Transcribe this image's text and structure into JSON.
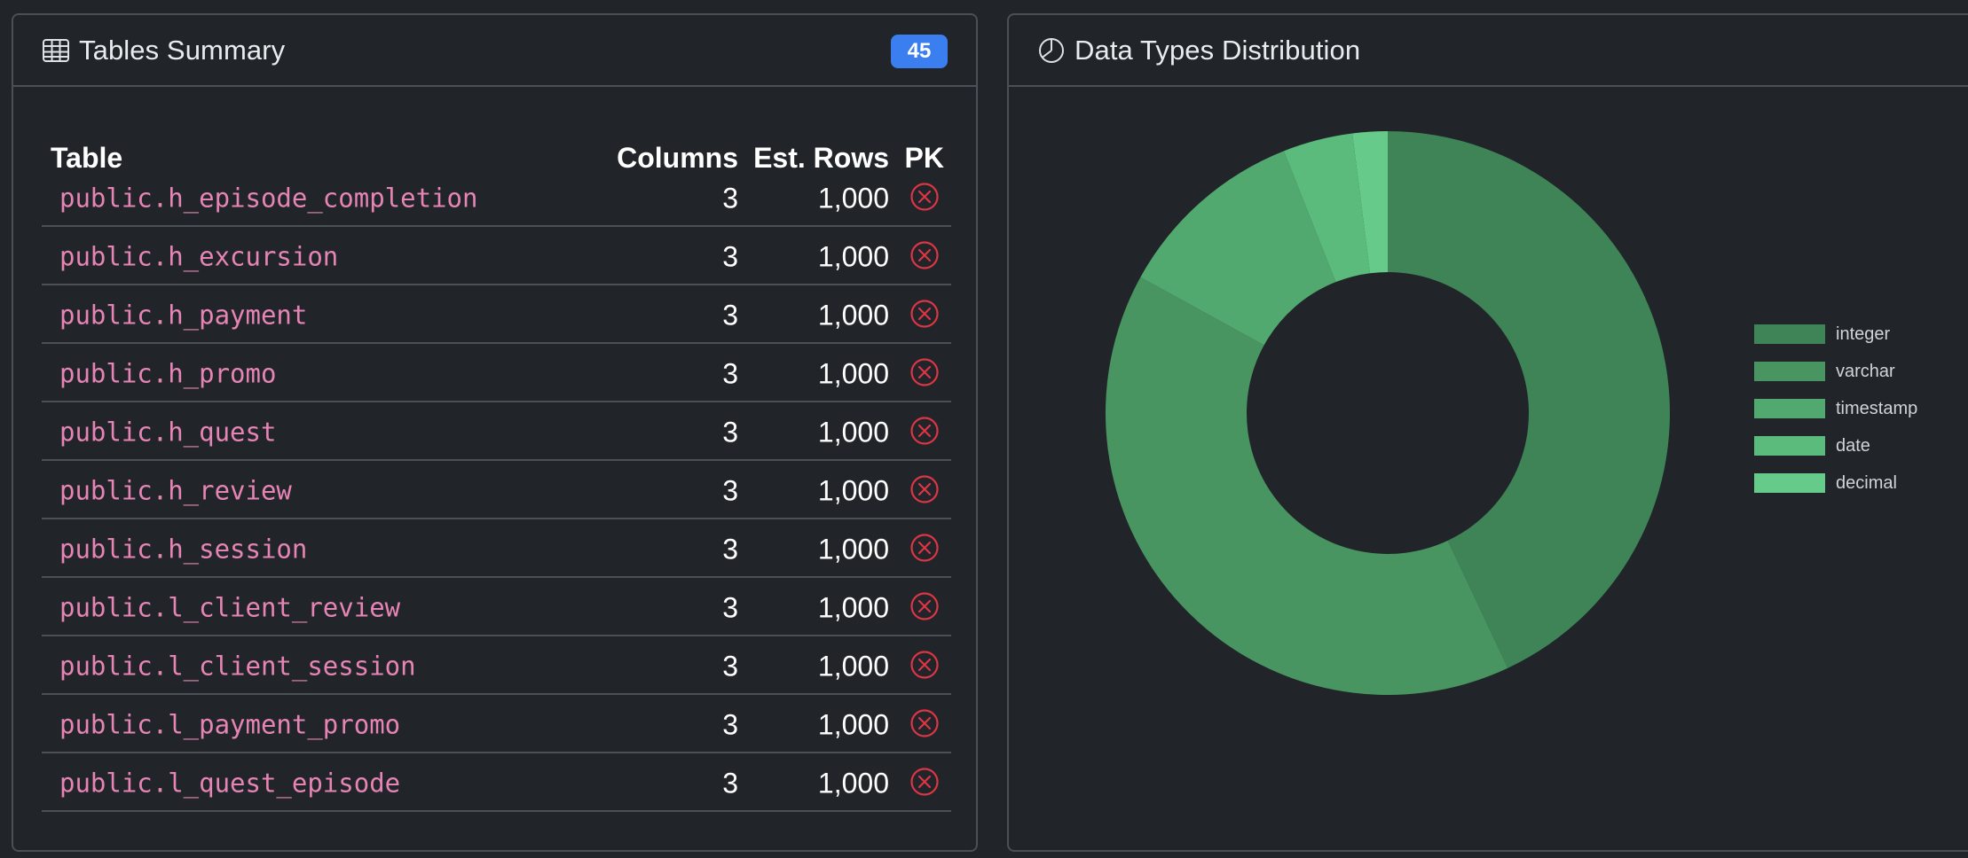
{
  "tables_card": {
    "title": "Tables Summary",
    "count_badge": "45",
    "columns": {
      "table": "Table",
      "columns": "Columns",
      "est_rows": "Est. Rows",
      "pk": "PK"
    },
    "rows": [
      {
        "name": "public.h_episode_completion",
        "columns": "3",
        "est_rows": "1,000",
        "pk": "no"
      },
      {
        "name": "public.h_excursion",
        "columns": "3",
        "est_rows": "1,000",
        "pk": "no"
      },
      {
        "name": "public.h_payment",
        "columns": "3",
        "est_rows": "1,000",
        "pk": "no"
      },
      {
        "name": "public.h_promo",
        "columns": "3",
        "est_rows": "1,000",
        "pk": "no"
      },
      {
        "name": "public.h_quest",
        "columns": "3",
        "est_rows": "1,000",
        "pk": "no"
      },
      {
        "name": "public.h_review",
        "columns": "3",
        "est_rows": "1,000",
        "pk": "no"
      },
      {
        "name": "public.h_session",
        "columns": "3",
        "est_rows": "1,000",
        "pk": "no"
      },
      {
        "name": "public.l_client_review",
        "columns": "3",
        "est_rows": "1,000",
        "pk": "no"
      },
      {
        "name": "public.l_client_session",
        "columns": "3",
        "est_rows": "1,000",
        "pk": "no"
      },
      {
        "name": "public.l_payment_promo",
        "columns": "3",
        "est_rows": "1,000",
        "pk": "no"
      },
      {
        "name": "public.l_quest_episode",
        "columns": "3",
        "est_rows": "1,000",
        "pk": "no"
      }
    ]
  },
  "types_card": {
    "title": "Data Types Distribution"
  },
  "chart_data": {
    "type": "pie",
    "donut": true,
    "title": "",
    "legend_position": "right",
    "categories": [
      "integer",
      "varchar",
      "timestamp",
      "date",
      "decimal"
    ],
    "values": [
      43,
      40,
      11,
      4,
      2
    ],
    "colors": [
      "#3f8457",
      "#489562",
      "#52a96f",
      "#5bbb7c",
      "#66cb8a"
    ]
  },
  "colors": {
    "background": "#212529",
    "border": "#495057",
    "table_name": "#e685b5",
    "pk_missing": "#dc3545",
    "badge": "#3b7ef0"
  },
  "icons": {
    "tables_header": "table-grid-icon",
    "types_header": "pie-chart-icon",
    "pk_missing": "x-circle-icon"
  }
}
